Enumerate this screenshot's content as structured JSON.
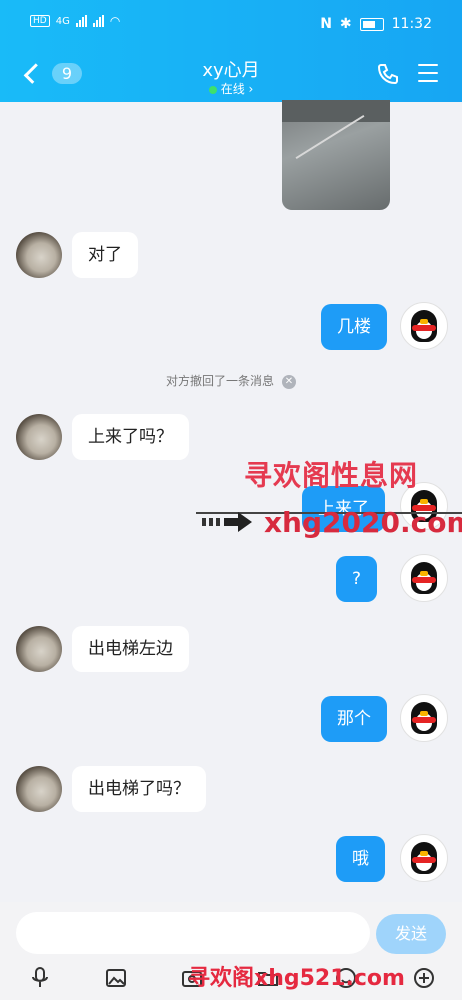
{
  "status": {
    "time": "11:32",
    "network": "4G",
    "nfc": "N"
  },
  "header": {
    "back_count": "9",
    "title": "xy心月",
    "subtitle": "在线 ›"
  },
  "messages": [
    {
      "side": "in",
      "text": "对了"
    },
    {
      "side": "out",
      "text": "几楼"
    },
    {
      "side": "system",
      "text": "对方撤回了一条消息"
    },
    {
      "side": "in",
      "text": "上来了吗？"
    },
    {
      "side": "out",
      "text": "上来了"
    },
    {
      "side": "out",
      "text": "?"
    },
    {
      "side": "in",
      "text": "出电梯左边"
    },
    {
      "side": "out",
      "text": "那个"
    },
    {
      "side": "in",
      "text": "出电梯了吗？"
    },
    {
      "side": "out",
      "text": "哦"
    }
  ],
  "watermarks": {
    "line1": "寻欢阁性息网",
    "line2": "xhg2020.com",
    "bottom": "寻欢阁xhg521.com"
  },
  "composer": {
    "placeholder": "",
    "send_label": "发送"
  },
  "icons": [
    "voice-icon",
    "image-icon",
    "camera-icon",
    "folder-icon",
    "emoji-icon",
    "plus-icon"
  ],
  "colors": {
    "header": "#17a6f3",
    "bubble_out": "#1e9cf7",
    "send": "#9fd4fb"
  }
}
